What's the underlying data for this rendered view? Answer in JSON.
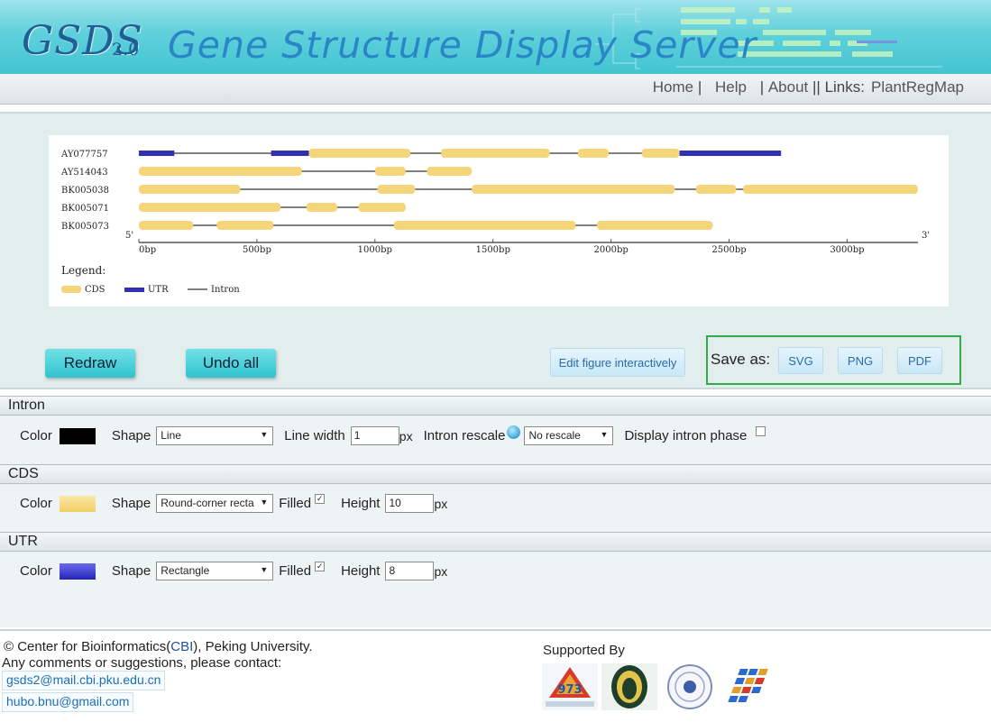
{
  "header": {
    "logo_text": "GSDS",
    "logo_version": "2.0",
    "title": "Gene Structure Display Server"
  },
  "nav": {
    "home": "Home",
    "sep1": " | ",
    "help": "Help",
    "sep2": " | ",
    "about": "About",
    "sep3": " || ",
    "links_label": "Links:",
    "plantregmap": "PlantRegMap"
  },
  "figure": {
    "genes": [
      {
        "name": "AY077757",
        "features": [
          {
            "type": "UTR",
            "start": 0,
            "end": 150
          },
          {
            "type": "UTR",
            "start": 560,
            "end": 720
          },
          {
            "type": "CDS",
            "start": 720,
            "end": 1150
          },
          {
            "type": "CDS",
            "start": 1280,
            "end": 1740
          },
          {
            "type": "CDS",
            "start": 1860,
            "end": 1990
          },
          {
            "type": "CDS",
            "start": 2130,
            "end": 2290
          },
          {
            "type": "UTR",
            "start": 2290,
            "end": 2720
          }
        ],
        "end": 2720
      },
      {
        "name": "AY514043",
        "features": [
          {
            "type": "CDS",
            "start": 0,
            "end": 690
          },
          {
            "type": "CDS",
            "start": 1000,
            "end": 1130
          },
          {
            "type": "CDS",
            "start": 1220,
            "end": 1410
          }
        ],
        "end": 1410
      },
      {
        "name": "BK005038",
        "features": [
          {
            "type": "CDS",
            "start": 0,
            "end": 430
          },
          {
            "type": "CDS",
            "start": 1010,
            "end": 1170
          },
          {
            "type": "CDS",
            "start": 1410,
            "end": 2270
          },
          {
            "type": "CDS",
            "start": 2360,
            "end": 2530
          },
          {
            "type": "CDS",
            "start": 2560,
            "end": 3300
          }
        ],
        "end": 3300
      },
      {
        "name": "BK005071",
        "features": [
          {
            "type": "CDS",
            "start": 0,
            "end": 600
          },
          {
            "type": "CDS",
            "start": 710,
            "end": 840
          },
          {
            "type": "CDS",
            "start": 930,
            "end": 1130
          }
        ],
        "end": 1130
      },
      {
        "name": "BK005073",
        "features": [
          {
            "type": "CDS",
            "start": 0,
            "end": 230
          },
          {
            "type": "CDS",
            "start": 330,
            "end": 570
          },
          {
            "type": "CDS",
            "start": 1080,
            "end": 1850
          },
          {
            "type": "CDS",
            "start": 1940,
            "end": 2430
          }
        ],
        "end": 2430
      }
    ],
    "axis": {
      "min": 0,
      "max": 3300,
      "ticks": [
        0,
        500,
        1000,
        1500,
        2000,
        2500,
        3000
      ],
      "tick_labels": [
        "0bp",
        "500bp",
        "1000bp",
        "1500bp",
        "2000bp",
        "2500bp",
        "3000bp"
      ],
      "five_prime": "5'",
      "three_prime": "3'"
    },
    "legend": {
      "title": "Legend:",
      "cds": "CDS",
      "utr": "UTR",
      "intron": "Intron"
    },
    "colors": {
      "cds": "#f5d57a",
      "utr": "#3030b0",
      "intron": "#555555"
    }
  },
  "controls": {
    "redraw": "Redraw",
    "undo_all": "Undo all",
    "edit_interactively": "Edit figure interactively",
    "save_as_label": "Save as:",
    "svg": "SVG",
    "png": "PNG",
    "pdf": "PDF"
  },
  "sections": {
    "intron": {
      "title": "Intron",
      "color_label": "Color",
      "color": "#000000",
      "shape_label": "Shape",
      "shape_value": "Line",
      "line_width_label": "Line width",
      "line_width_value": "1",
      "px": "px",
      "rescale_label": "Intron rescale",
      "rescale_value": "No rescale",
      "phase_label": "Display intron phase",
      "phase_checked": false
    },
    "cds": {
      "title": "CDS",
      "color_label": "Color",
      "color": "#f5d57a",
      "shape_label": "Shape",
      "shape_value": "Round-corner recta",
      "filled_label": "Filled",
      "height_label": "Height",
      "height_value": "10",
      "px": "px"
    },
    "utr": {
      "title": "UTR",
      "color_label": "Color",
      "color": "#3838c8",
      "shape_label": "Shape",
      "shape_value": "Rectangle",
      "filled_label": "Filled",
      "height_label": "Height",
      "height_value": "8",
      "px": "px"
    },
    "check_mark": "✓"
  },
  "footer": {
    "copyright_prefix": "© Center for Bioinformatics(",
    "cbi": "CBI",
    "copyright_suffix": "), Peking University.",
    "comments": "Any comments or suggestions, please contact:",
    "email1": "gsds2@mail.cbi.pku.edu.cn",
    "email2": "hubo.bnu@gmail.com",
    "supported_by": "Supported By",
    "logo_973": "973"
  }
}
